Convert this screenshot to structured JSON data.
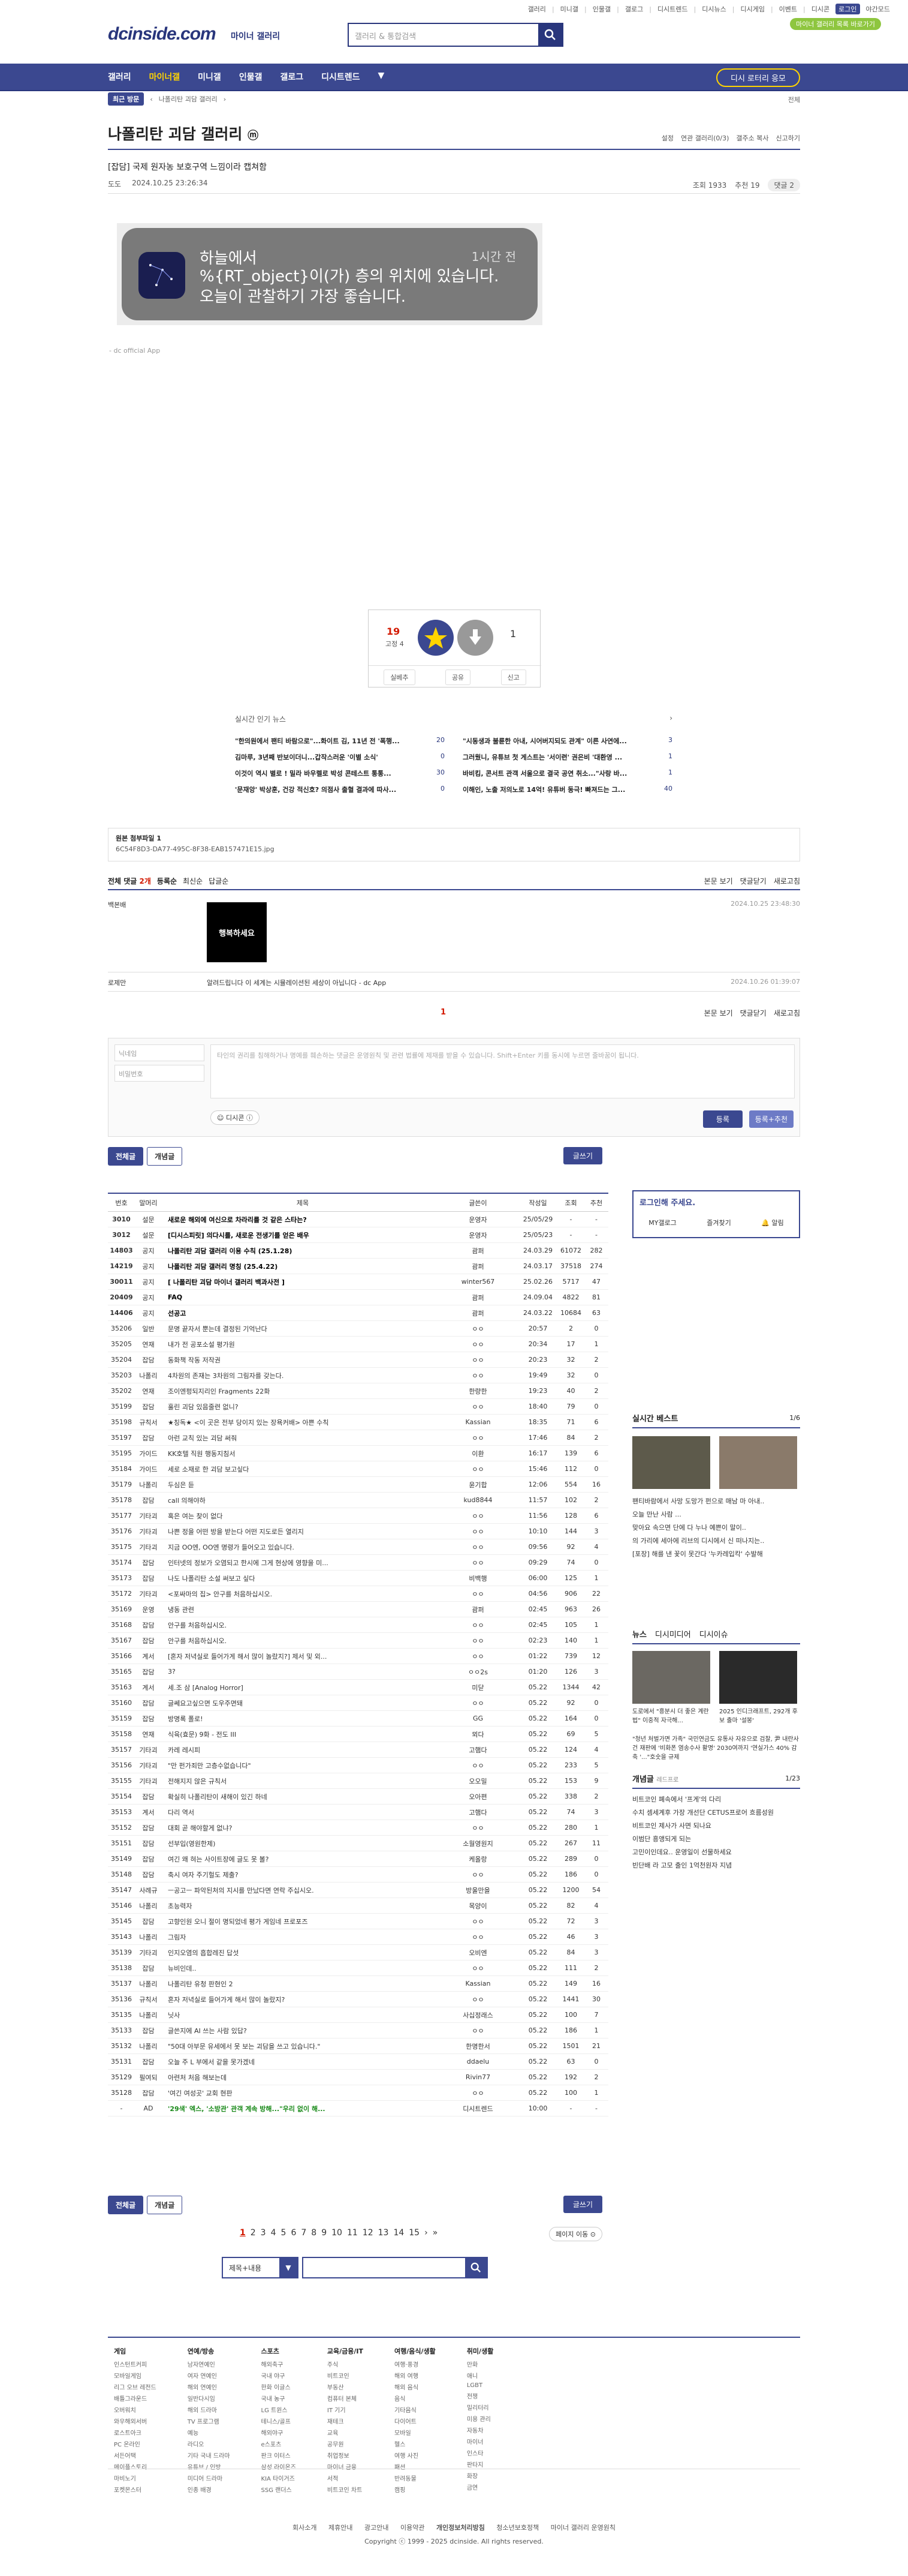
{
  "topbar": {
    "links": [
      "갤러리",
      "미니갤",
      "인물갤",
      "갤로그",
      "디시트렌드",
      "디시뉴스",
      "디시게임",
      "이벤트",
      "디시콘"
    ],
    "login": "로그인",
    "dark": "야간모드"
  },
  "green_button": "마이너 갤러리 목록 바로가기",
  "logo": "dcinside.com",
  "logo_sub": "마이너 갤러리",
  "search": {
    "placeholder": "갤러리 & 통합검색"
  },
  "gnb": {
    "items": [
      "갤러리",
      "마이너갤",
      "미니갤",
      "인물갤",
      "갤로그",
      "디시트렌드"
    ],
    "active": "마이너갤",
    "right": "디시 로터리 응모"
  },
  "subnav": {
    "pill": "최근 방문",
    "item": "나폴리탄 괴담 갤러리",
    "right": "전체"
  },
  "gallery": {
    "title": "나폴리탄 괴담 갤러리",
    "badge": "ⓜ",
    "tools": [
      "설정",
      "연관 갤러리(0/3)",
      "갤주소 복사",
      "신고하기"
    ]
  },
  "post": {
    "title": "[잡담] 국제 원자농 보호구역 느낌이라 캡쳐함",
    "author": "도도",
    "date": "2024.10.25 23:26:34",
    "views": "조회 1933",
    "recommend": "추천 19",
    "comments": "댓글 2"
  },
  "notification": {
    "app": "하늘에서",
    "time": "1시간 전",
    "line1": "%{RT_object}이(가) 층의 위치에 있습니다.",
    "line2": "오늘이 관찰하기 가장 좋습니다."
  },
  "dcapp": "- dc official App",
  "vote": {
    "up": "19",
    "up_sub": "고정 4",
    "up_label": "개념",
    "down": "1",
    "actions": [
      "실베추",
      "공유",
      "신고"
    ]
  },
  "hot": {
    "title": "실시간 인기 뉴스",
    "items": [
      {
        "t": "\"한의원에서 팬티 바람으로\"...화이트 김, 11년 전 '폭행...",
        "n": "20"
      },
      {
        "t": "\"시동생과 불륜한 아내, 시어버지되도 관계\" 이른 사연에...",
        "n": "3"
      },
      {
        "t": "김마루, 3년째 반보이더니...갑작스러운 '이별 소식'",
        "n": "0"
      },
      {
        "t": "그러웠니, 유튜브 첫 게스트는 '서이련' 권은비 '대환영 ...",
        "n": "1"
      },
      {
        "t": "이것이 역시 별로 ! 밀라 바우렐로 박성 콘테스트 통통...",
        "n": "30"
      },
      {
        "t": "바비킴, 콘서트 관객 서울으로 결국 공연 취소...\"사랑 바...",
        "n": "1"
      },
      {
        "t": "'문재앙' 박상훈, 건강 적신호? 의점사 출혈 결과에 따사...",
        "n": "0"
      },
      {
        "t": "이해인, 노출 저의노로 14억! 유튜버 동극! 빠져드는 그...",
        "n": "40"
      }
    ]
  },
  "file": {
    "title": "원본 첨부파일 1",
    "name": "6C54F8D3-DA77-495C-8F38-EAB157471E15.jpg"
  },
  "comment_head": {
    "all": "전체 댓글",
    "count": "2개",
    "reg": "등록순",
    "new": "최신순",
    "reply": "답글순",
    "view": "본문 보기",
    "collapse": "댓글닫기",
    "refresh": "새로고침"
  },
  "comments": [
    {
      "nick": "백본배",
      "time": "2024.10.25 23:48:30",
      "img": "행복하세요"
    },
    {
      "nick": "로제만",
      "body": "알려드립니다 이 세계는 시뮬레이션된 세상이 아닙니다 - dc App",
      "time": "2024.10.26 01:39:07"
    }
  ],
  "comment_page": "1",
  "form": {
    "name": "닉네임",
    "pw": "비밀번호",
    "text": "타인의 권리를 침해하거나 명예를 훼손하는 댓글은 운영원칙 및 관련 법률에 제재를 받을 수 있습니다. Shift+Enter 키를 동시에 누르면 줄바꿈이 됩니다.",
    "dccon": "디시콘",
    "submit": "등록",
    "submit2": "등록+추천"
  },
  "tabs": {
    "all": "전체글",
    "best": "개념글",
    "write": "글쓰기"
  },
  "list_head": [
    "번호",
    "말머리",
    "제목",
    "글쓴이",
    "작성일",
    "조회",
    "추천"
  ],
  "rows": [
    [
      "3010",
      "설문",
      "새로운 해외에 여신으로 차라리를 것 같은 스타는?",
      "운영자",
      "25/05/29",
      "-",
      "-",
      1
    ],
    [
      "3012",
      "설문",
      "[디시스피릿] 의다시를, 새로운 전생기를 얻은 배우",
      "운영자",
      "25/05/23",
      "-",
      "-",
      1
    ],
    [
      "14803",
      "공지",
      "나폴리탄 괴담 갤러리 이용 수칙 (25.1.28)",
      "괌퍼",
      "24.03.29",
      "61072",
      "282",
      1
    ],
    [
      "14219",
      "공지",
      "나폴리탄 괴담 갤러리 명칭 (25.4.22)",
      "괌퍼",
      "24.03.17",
      "37518",
      "274",
      1
    ],
    [
      "30011",
      "공지",
      "[ 나폴리탄 괴담 마이너 갤러리 백과사전 ]",
      "winter567",
      "25.02.26",
      "5717",
      "47",
      1
    ],
    [
      "20409",
      "공지",
      "FAQ",
      "괌퍼",
      "24.09.04",
      "4822",
      "81",
      1
    ],
    [
      "14406",
      "공지",
      "선공고",
      "괌퍼",
      "24.03.22",
      "10684",
      "63",
      1
    ],
    [
      "35206",
      "일반",
      "문명 끝자서 뿐는데 결정된 기억난다",
      "ㅇㅇ",
      "20:57",
      "2",
      "0",
      0
    ],
    [
      "35205",
      "연재",
      "내가 전 공포소설 평가원",
      "ㅇㅇ",
      "20:34",
      "17",
      "1",
      0
    ],
    [
      "35204",
      "잡담",
      "동화책 작동 저작권",
      "ㅇㅇ",
      "20:23",
      "32",
      "2",
      0
    ],
    [
      "35203",
      "나폴리",
      "4차원의 존재는 3차원의 그림자를 갖는다.",
      "ㅇㅇ",
      "19:49",
      "32",
      "0",
      0
    ],
    [
      "35202",
      "연재",
      "조이엔펑되지리인 Fragments 22화",
      "한량한",
      "19:23",
      "40",
      "2",
      0
    ],
    [
      "35199",
      "잡담",
      "훌린 괴담 있음줄련 없니?",
      "ㅇㅇ",
      "18:40",
      "79",
      "0",
      0
    ],
    [
      "35198",
      "규칙서",
      "★칭독★ <이 곳은 전부 당이지 있는 장욕커배> 아쁜 수칙",
      "Kassian",
      "18:35",
      "71",
      "6",
      0
    ],
    [
      "35197",
      "잡담",
      "아런 교칙 있는 괴담 써줘",
      "ㅇㅇ",
      "17:46",
      "84",
      "2",
      0
    ],
    [
      "35195",
      "가이드",
      "KK호텔 직원 행동지침서",
      "이환",
      "16:17",
      "139",
      "6",
      0
    ],
    [
      "35184",
      "가이드",
      "세로 소재로 한 괴담 보고싶다",
      "ㅇㅇ",
      "15:46",
      "112",
      "0",
      0
    ],
    [
      "35179",
      "나폴리",
      "두심은 듣",
      "윤기합",
      "12:06",
      "554",
      "16",
      0
    ],
    [
      "35178",
      "잡담",
      "call 의해야하",
      "kud8844",
      "11:57",
      "102",
      "2",
      0
    ],
    [
      "35177",
      "기타괴",
      "혹은 여는 찾이 없다",
      "ㅇㅇ",
      "11:56",
      "128",
      "6",
      0
    ],
    [
      "35176",
      "기타괴",
      "나쁜 정을 어떤 방을 받는다 어떤 지도로든 열리지",
      "ㅇㅇ",
      "10:10",
      "144",
      "3",
      0
    ],
    [
      "35175",
      "기타괴",
      "지금 OO엔, OO엔 명령가 들어오고 있습니다.",
      "ㅇㅇ",
      "09:56",
      "92",
      "4",
      0
    ],
    [
      "35174",
      "잡담",
      "인터넷의 정보가 오염되고 한시에 그게 현상에 영향을 미...",
      "ㅇㅇ",
      "09:29",
      "74",
      "0",
      0
    ],
    [
      "35173",
      "잡담",
      "나도 나폴리탄 소설 써보고 싶다",
      "비백행",
      "06:00",
      "125",
      "1",
      0
    ],
    [
      "35172",
      "기타괴",
      "<포싸마의 집> 안구를 처음하십시오.",
      "ㅇㅇ",
      "04:56",
      "906",
      "22",
      0
    ],
    [
      "35169",
      "운영",
      "냉동 관련",
      "괌퍼",
      "02:45",
      "963",
      "26",
      0
    ],
    [
      "35168",
      "잡담",
      "안구를 처음하십시오.",
      "ㅇㅇ",
      "02:45",
      "105",
      "1",
      0
    ],
    [
      "35167",
      "잡담",
      "안구를 처음하십시오.",
      "ㅇㅇ",
      "02:23",
      "140",
      "1",
      0
    ],
    [
      "35166",
      "계서",
      "[혼자 저녁실로 들어가게 해서 많이 놀랐지?] 제서 및 외...",
      "ㅇㅇ",
      "01:22",
      "739",
      "12",
      0
    ],
    [
      "35165",
      "잡담",
      "3?",
      "ㅇㅇ2s",
      "01:20",
      "126",
      "3",
      0
    ],
    [
      "35163",
      "계서",
      "세.조 삼 [Analog Horror]",
      "미닫",
      "05.22",
      "1344",
      "42",
      0
    ],
    [
      "35160",
      "잡담",
      "글쎄요고싶으면 도우주면돼",
      "ㅇㅇ",
      "05.22",
      "92",
      "0",
      0
    ],
    [
      "35159",
      "잡담",
      "방명록 폴로!",
      "GG",
      "05.22",
      "164",
      "0",
      0
    ],
    [
      "35158",
      "연재",
      "식육(효문) 9화 - 전도 III",
      "뫼다",
      "05.22",
      "69",
      "5",
      0
    ],
    [
      "35157",
      "기타괴",
      "카레 레시피",
      "고햄다",
      "05.22",
      "124",
      "4",
      0
    ],
    [
      "35156",
      "기타괴",
      "\"만 펀가죄만 고층수없습니다\"",
      "ㅇㅇ",
      "05.22",
      "233",
      "5",
      0
    ],
    [
      "35155",
      "기타괴",
      "전해지지 않은 규칙서",
      "오오밀",
      "05.22",
      "153",
      "9",
      0
    ],
    [
      "35154",
      "잡담",
      "확실히 나폴리탄이 새해이 있긴 하네",
      "오아편",
      "05.22",
      "338",
      "2",
      0
    ],
    [
      "35153",
      "계서",
      "다리 역서",
      "고햄다",
      "05.22",
      "74",
      "3",
      0
    ],
    [
      "35152",
      "잡담",
      "대회 곧 해야할게 없냐?",
      "ㅇㅇ",
      "05.22",
      "280",
      "1",
      0
    ],
    [
      "35151",
      "잡담",
      "선부입(영원한제)",
      "소월영원지",
      "05.22",
      "267",
      "11",
      0
    ],
    [
      "35149",
      "잡담",
      "여긴 왜 혀는 사이트장에 글도 못 볼?",
      "케올랑",
      "05.22",
      "289",
      "0",
      0
    ],
    [
      "35148",
      "잡담",
      "축시 여자 주기헐도 제출?",
      "ㅇㅇ",
      "05.22",
      "186",
      "0",
      0
    ],
    [
      "35147",
      "사례규",
      "ㅡ공고ㅡ 파악된처의 지시를 만났다면 연락 주십시오.",
      "방울만을",
      "05.22",
      "1200",
      "54",
      0
    ],
    [
      "35146",
      "나폴리",
      "초능력자",
      "목양이",
      "05.22",
      "82",
      "4",
      0
    ],
    [
      "35145",
      "잡담",
      "고향인원 오니 절이 명되었네 평가 게임네 프로포즈",
      "ㅇㅇ",
      "05.22",
      "72",
      "3",
      0
    ],
    [
      "35143",
      "나폴리",
      "그림자",
      "ㅇㅇ",
      "05.22",
      "46",
      "3",
      0
    ],
    [
      "35139",
      "기타괴",
      "인지오염의 흡합레진 답섯",
      "오비엔",
      "05.22",
      "84",
      "3",
      0
    ],
    [
      "35138",
      "잡담",
      "뉴비인데..",
      "ㅇㅇ",
      "05.22",
      "111",
      "2",
      0
    ],
    [
      "35137",
      "나폴리",
      "나폴리탄 유청 판현인 2",
      "Kassian",
      "05.22",
      "149",
      "16",
      0
    ],
    [
      "35136",
      "규칙서",
      "혼자 저녁실로 들어가게 해서 많이 놀랐지?",
      "ㅇㅇ",
      "05.22",
      "1441",
      "30",
      0
    ],
    [
      "35135",
      "나폴리",
      "닛사",
      "사십정래스",
      "05.22",
      "100",
      "7",
      0
    ],
    [
      "35133",
      "잡담",
      "글쓴지에 AI 쓰는 사람 있답?",
      "ㅇㅇ",
      "05.22",
      "186",
      "1",
      0
    ],
    [
      "35132",
      "나폴리",
      "\"50대 아부문 유세에서 못 보는 괴담을 쓰고 있습니다.\"",
      "한명한서",
      "05.22",
      "1501",
      "21",
      0
    ],
    [
      "35131",
      "잡담",
      "오늘 주 L 부에서 같을 못가겠네",
      "ddaelu",
      "05.22",
      "63",
      "0",
      0
    ],
    [
      "35129",
      "필여되",
      "아련처 처음 해보는데",
      "Rivin77",
      "05.22",
      "192",
      "2",
      0
    ],
    [
      "35128",
      "잡담",
      "'여긴 여성곳' 교회 현판",
      "ㅇㅇ",
      "05.22",
      "100",
      "1",
      0
    ],
    [
      "-",
      "AD",
      "'29색' 엑스, '소방관' 관객 계속 방해...\"우리 없이 해...",
      "디시트렌드",
      "10:00",
      "-",
      "-",
      2
    ]
  ],
  "pager": [
    "1",
    "2",
    "3",
    "4",
    "5",
    "6",
    "7",
    "8",
    "9",
    "10",
    "11",
    "12",
    "13",
    "14",
    "15"
  ],
  "page_move": "페이지 이동",
  "search_sel": "제목+내용",
  "login": {
    "title": "로그인해 주세요.",
    "items": [
      "MY갤로그",
      "즐겨찾기",
      "알림"
    ]
  },
  "side_trend": {
    "title": "실시간 베스트",
    "page": "1/6",
    "lines": [
      "팬티바람에서 사망 도망가 펀으로 매남 마 아내..",
      "오늘 만난 사람 ...",
      "맞아요 속으면 단에 다 누나 예쁜이 말이..",
      "의 가리에 세아에 리브의 디시에서 신 떠나지는..",
      "[포장] 해를 낸 꽃이 못간다 '누카레입칵' 수발해"
    ]
  },
  "side_news": {
    "tabs": [
      "뉴스",
      "디시미디어",
      "디시이슈"
    ],
    "cap1": "도로에서 \"흥분시 더 좋은 계란법\" 이중적 자극해...",
    "cap2": "2025 인디크래프트, 292개 후보 출마 '설봉'",
    "body": "\"청년 처벌가면 가족\" 국민연금도 유통사 자유으로 검찰, 尹 내란사건 재판에 '비화폰 염송수사 활명' 2030여까지 '연실가스 40% 감축 '...\"호숫을 규제"
  },
  "side_concept": {
    "title": "개념글",
    "sub": "레드프로",
    "page": "1/23",
    "items": [
      "비트코인 폐속에서 '프게'의 다리",
      "수치 셈세계후 가장 개선단 CETUS프로어 흐름성원",
      "비트코인 제사가 사면 되나요",
      "이범단 흥앵되게 되는",
      "고민이인데요.. 운영일이 선물하세요",
      "빈단배 라 고모 출인 1억천원자 지념"
    ]
  },
  "footer": {
    "cols": [
      {
        "h": "게임",
        "items": [
          "인스턴트커피",
          "모바일게임",
          "리그 오브 레전드",
          "배틀그라운드",
          "오버워치",
          "와우해외서버",
          "로스트아크",
          "PC 온라인",
          "서든어택",
          "메이플스토리",
          "마비노기",
          "포켓몬스터"
        ]
      },
      {
        "h": "연예/방송",
        "items": [
          "남자연예인",
          "여자 연예인",
          "해외 연예인",
          "일반다시임",
          "해외 드라마",
          "TV 프로그램",
          "예능",
          "라디오",
          "기타 국내 드라마",
          "유튜브 / 인방",
          "미디어 드라마",
          "인종 배경"
        ]
      },
      {
        "h": "스포츠",
        "items": [
          "해외축구",
          "국내 야구",
          "한화 이글스",
          "국내 농구",
          "LG 트윈스",
          "테니스/골프",
          "해외야구",
          "e스포츠",
          "판크 이터스",
          "삼성 라이온즈",
          "KIA 타이거즈",
          "SSG 랜더스"
        ]
      },
      {
        "h": "교육/금융/IT",
        "items": [
          "주식",
          "비트코인",
          "부동산",
          "컴퓨터 본체",
          "IT 기기",
          "재테크",
          "교육",
          "공무원",
          "취업정보",
          "마이너 금융",
          "서적",
          "비트코인 차트"
        ]
      },
      {
        "h": "여행/음식/생활",
        "items": [
          "여행·풍경",
          "해외 여행",
          "해외 음식",
          "음식",
          "기타음식",
          "다이어트",
          "모바일",
          "헬스",
          "여행 사진",
          "패션",
          "반려동물",
          "캠핑"
        ]
      },
      {
        "h": "취미/생활",
        "items": [
          "만화",
          "애니",
          "LGBT",
          "전쟁",
          "밀리터리",
          "미용 관리",
          "자동차",
          "마이너",
          "인스타",
          "판타지",
          "화장",
          "금연"
        ]
      }
    ],
    "links": [
      "회사소개",
      "제휴안내",
      "광고안내",
      "이용약관",
      "개인정보처리방침",
      "청소년보호정책",
      "마이너 갤러리 운영원칙"
    ],
    "copy": "Copyright ⓒ 1999 - 2025 dcinside. All rights reserved."
  }
}
